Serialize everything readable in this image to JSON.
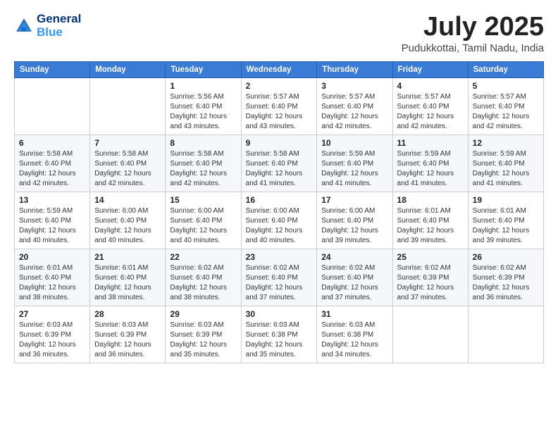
{
  "header": {
    "logo_line1": "General",
    "logo_line2": "Blue",
    "title": "July 2025",
    "subtitle": "Pudukkottai, Tamil Nadu, India"
  },
  "days_of_week": [
    "Sunday",
    "Monday",
    "Tuesday",
    "Wednesday",
    "Thursday",
    "Friday",
    "Saturday"
  ],
  "weeks": [
    [
      null,
      null,
      {
        "num": "1",
        "sunrise": "Sunrise: 5:56 AM",
        "sunset": "Sunset: 6:40 PM",
        "daylight": "Daylight: 12 hours and 43 minutes."
      },
      {
        "num": "2",
        "sunrise": "Sunrise: 5:57 AM",
        "sunset": "Sunset: 6:40 PM",
        "daylight": "Daylight: 12 hours and 43 minutes."
      },
      {
        "num": "3",
        "sunrise": "Sunrise: 5:57 AM",
        "sunset": "Sunset: 6:40 PM",
        "daylight": "Daylight: 12 hours and 42 minutes."
      },
      {
        "num": "4",
        "sunrise": "Sunrise: 5:57 AM",
        "sunset": "Sunset: 6:40 PM",
        "daylight": "Daylight: 12 hours and 42 minutes."
      },
      {
        "num": "5",
        "sunrise": "Sunrise: 5:57 AM",
        "sunset": "Sunset: 6:40 PM",
        "daylight": "Daylight: 12 hours and 42 minutes."
      }
    ],
    [
      {
        "num": "6",
        "sunrise": "Sunrise: 5:58 AM",
        "sunset": "Sunset: 6:40 PM",
        "daylight": "Daylight: 12 hours and 42 minutes."
      },
      {
        "num": "7",
        "sunrise": "Sunrise: 5:58 AM",
        "sunset": "Sunset: 6:40 PM",
        "daylight": "Daylight: 12 hours and 42 minutes."
      },
      {
        "num": "8",
        "sunrise": "Sunrise: 5:58 AM",
        "sunset": "Sunset: 6:40 PM",
        "daylight": "Daylight: 12 hours and 42 minutes."
      },
      {
        "num": "9",
        "sunrise": "Sunrise: 5:58 AM",
        "sunset": "Sunset: 6:40 PM",
        "daylight": "Daylight: 12 hours and 41 minutes."
      },
      {
        "num": "10",
        "sunrise": "Sunrise: 5:59 AM",
        "sunset": "Sunset: 6:40 PM",
        "daylight": "Daylight: 12 hours and 41 minutes."
      },
      {
        "num": "11",
        "sunrise": "Sunrise: 5:59 AM",
        "sunset": "Sunset: 6:40 PM",
        "daylight": "Daylight: 12 hours and 41 minutes."
      },
      {
        "num": "12",
        "sunrise": "Sunrise: 5:59 AM",
        "sunset": "Sunset: 6:40 PM",
        "daylight": "Daylight: 12 hours and 41 minutes."
      }
    ],
    [
      {
        "num": "13",
        "sunrise": "Sunrise: 5:59 AM",
        "sunset": "Sunset: 6:40 PM",
        "daylight": "Daylight: 12 hours and 40 minutes."
      },
      {
        "num": "14",
        "sunrise": "Sunrise: 6:00 AM",
        "sunset": "Sunset: 6:40 PM",
        "daylight": "Daylight: 12 hours and 40 minutes."
      },
      {
        "num": "15",
        "sunrise": "Sunrise: 6:00 AM",
        "sunset": "Sunset: 6:40 PM",
        "daylight": "Daylight: 12 hours and 40 minutes."
      },
      {
        "num": "16",
        "sunrise": "Sunrise: 6:00 AM",
        "sunset": "Sunset: 6:40 PM",
        "daylight": "Daylight: 12 hours and 40 minutes."
      },
      {
        "num": "17",
        "sunrise": "Sunrise: 6:00 AM",
        "sunset": "Sunset: 6:40 PM",
        "daylight": "Daylight: 12 hours and 39 minutes."
      },
      {
        "num": "18",
        "sunrise": "Sunrise: 6:01 AM",
        "sunset": "Sunset: 6:40 PM",
        "daylight": "Daylight: 12 hours and 39 minutes."
      },
      {
        "num": "19",
        "sunrise": "Sunrise: 6:01 AM",
        "sunset": "Sunset: 6:40 PM",
        "daylight": "Daylight: 12 hours and 39 minutes."
      }
    ],
    [
      {
        "num": "20",
        "sunrise": "Sunrise: 6:01 AM",
        "sunset": "Sunset: 6:40 PM",
        "daylight": "Daylight: 12 hours and 38 minutes."
      },
      {
        "num": "21",
        "sunrise": "Sunrise: 6:01 AM",
        "sunset": "Sunset: 6:40 PM",
        "daylight": "Daylight: 12 hours and 38 minutes."
      },
      {
        "num": "22",
        "sunrise": "Sunrise: 6:02 AM",
        "sunset": "Sunset: 6:40 PM",
        "daylight": "Daylight: 12 hours and 38 minutes."
      },
      {
        "num": "23",
        "sunrise": "Sunrise: 6:02 AM",
        "sunset": "Sunset: 6:40 PM",
        "daylight": "Daylight: 12 hours and 37 minutes."
      },
      {
        "num": "24",
        "sunrise": "Sunrise: 6:02 AM",
        "sunset": "Sunset: 6:40 PM",
        "daylight": "Daylight: 12 hours and 37 minutes."
      },
      {
        "num": "25",
        "sunrise": "Sunrise: 6:02 AM",
        "sunset": "Sunset: 6:39 PM",
        "daylight": "Daylight: 12 hours and 37 minutes."
      },
      {
        "num": "26",
        "sunrise": "Sunrise: 6:02 AM",
        "sunset": "Sunset: 6:39 PM",
        "daylight": "Daylight: 12 hours and 36 minutes."
      }
    ],
    [
      {
        "num": "27",
        "sunrise": "Sunrise: 6:03 AM",
        "sunset": "Sunset: 6:39 PM",
        "daylight": "Daylight: 12 hours and 36 minutes."
      },
      {
        "num": "28",
        "sunrise": "Sunrise: 6:03 AM",
        "sunset": "Sunset: 6:39 PM",
        "daylight": "Daylight: 12 hours and 36 minutes."
      },
      {
        "num": "29",
        "sunrise": "Sunrise: 6:03 AM",
        "sunset": "Sunset: 6:39 PM",
        "daylight": "Daylight: 12 hours and 35 minutes."
      },
      {
        "num": "30",
        "sunrise": "Sunrise: 6:03 AM",
        "sunset": "Sunset: 6:38 PM",
        "daylight": "Daylight: 12 hours and 35 minutes."
      },
      {
        "num": "31",
        "sunrise": "Sunrise: 6:03 AM",
        "sunset": "Sunset: 6:38 PM",
        "daylight": "Daylight: 12 hours and 34 minutes."
      },
      null,
      null
    ]
  ]
}
